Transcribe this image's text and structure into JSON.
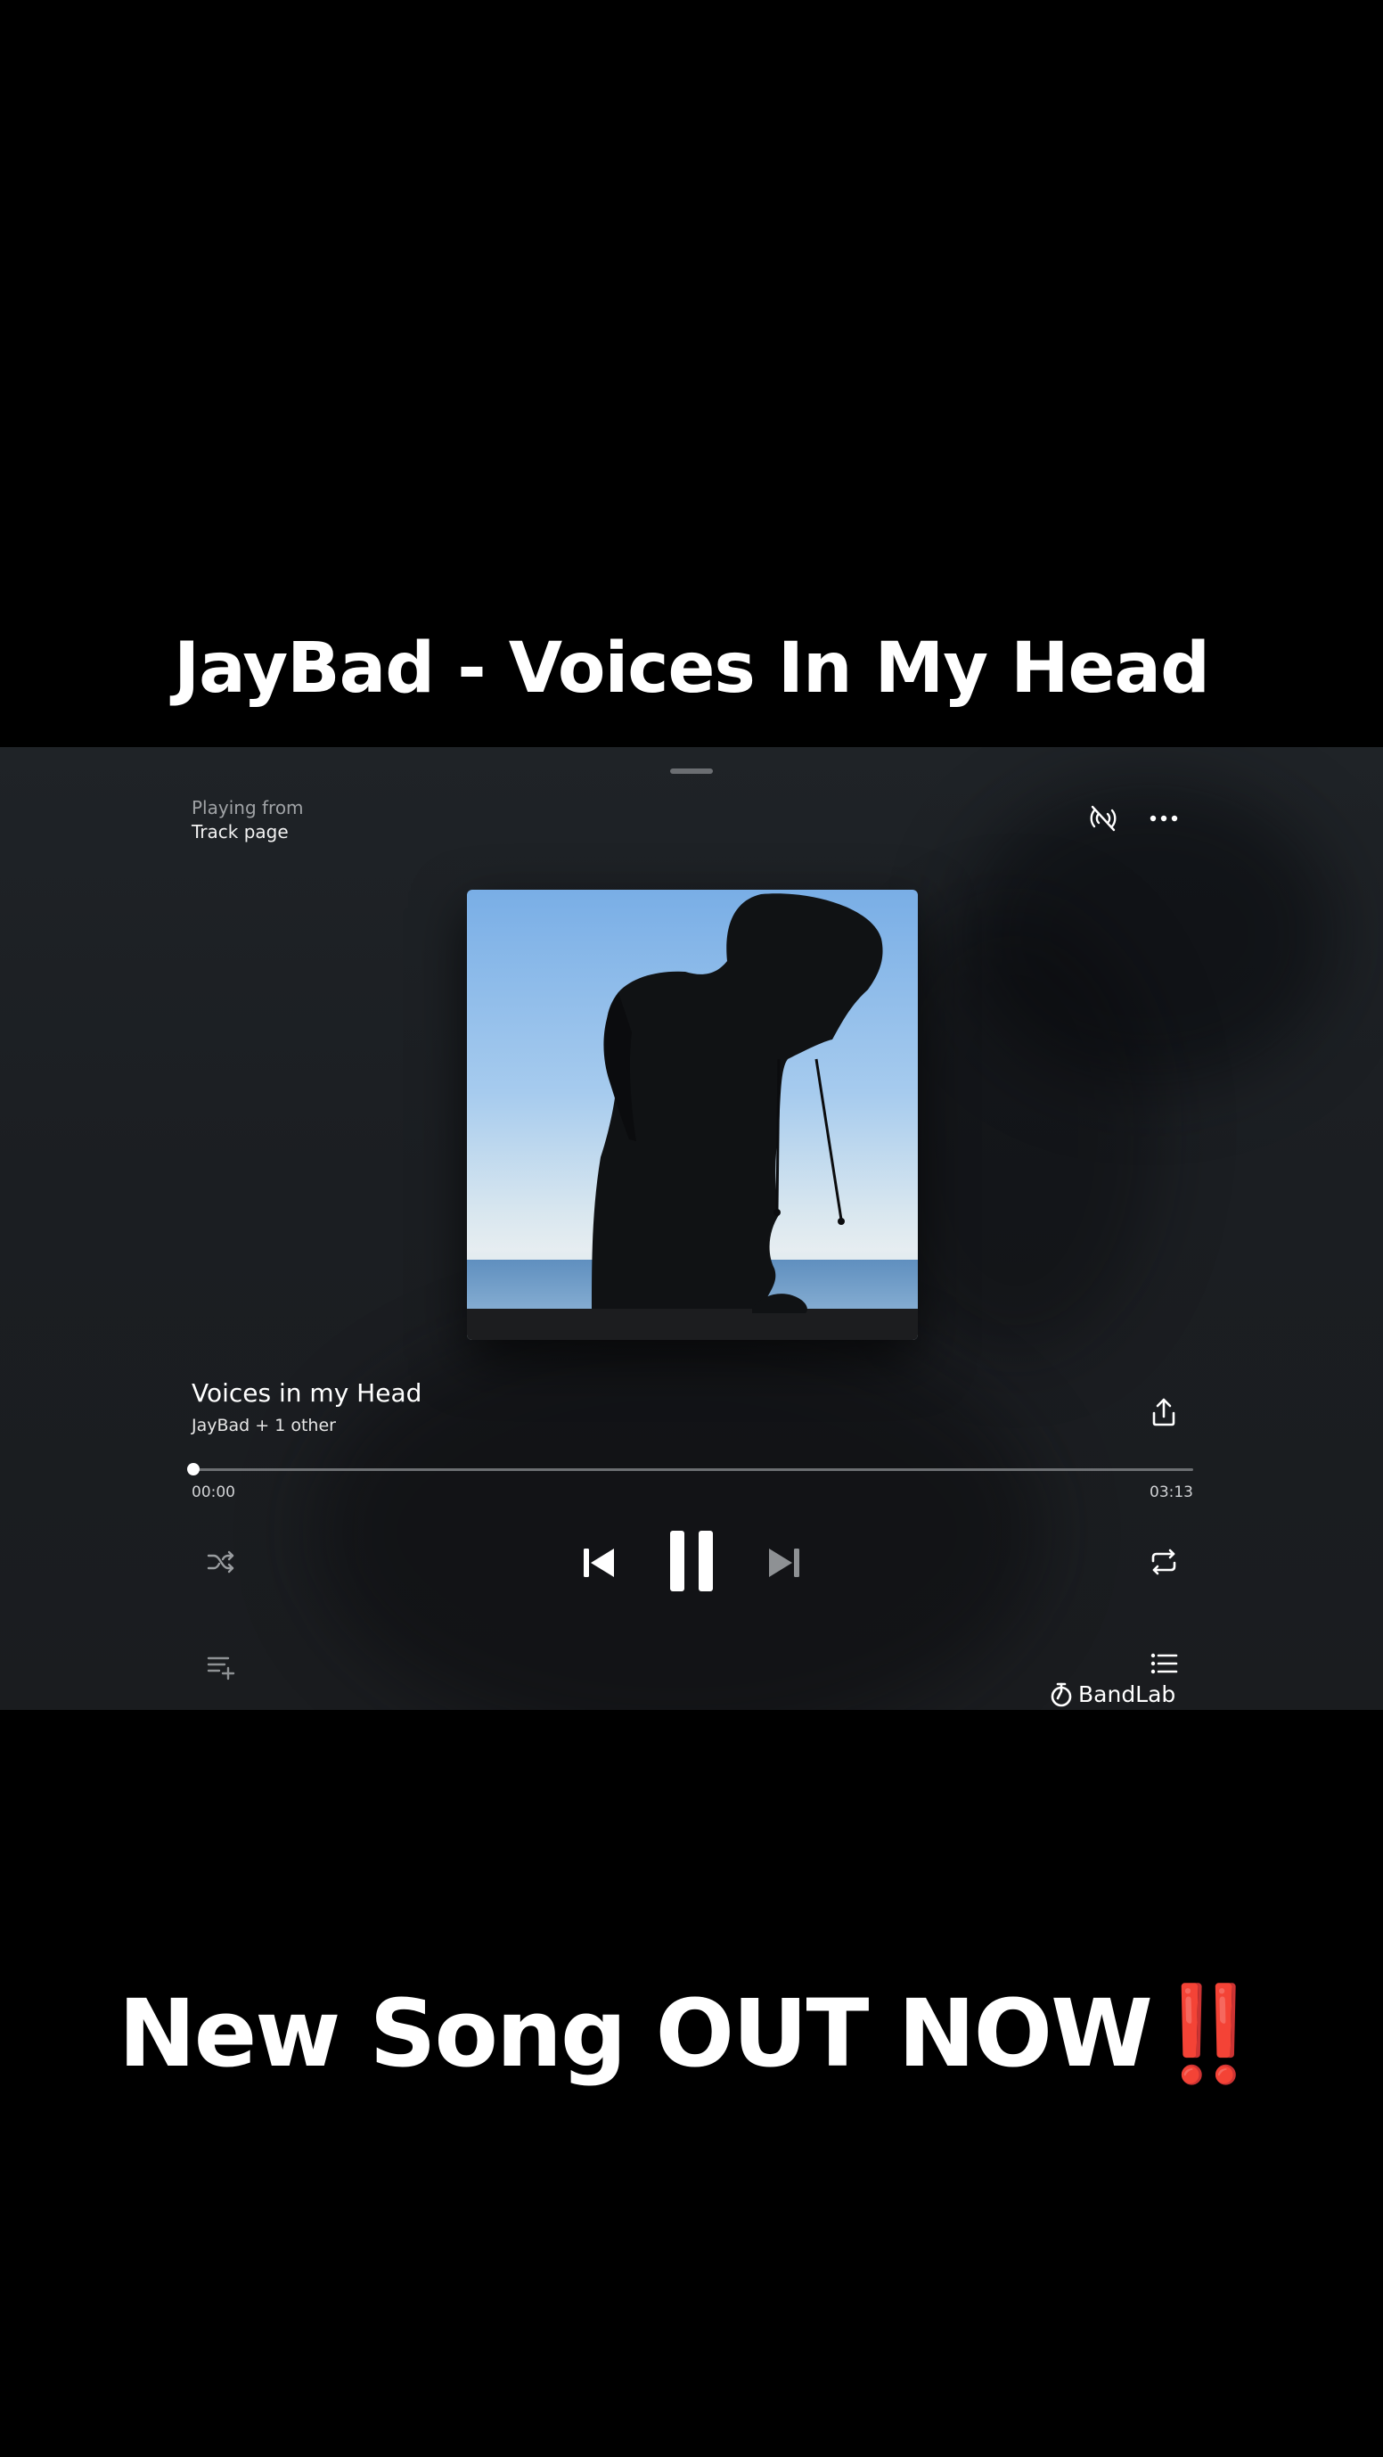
{
  "captions": {
    "top": "JayBad - Voices In My Head",
    "bottom_text": "New Song OUT NOW",
    "bottom_emoji": "‼️"
  },
  "player": {
    "playing_from_label": "Playing from",
    "playing_from_source": "Track page",
    "track": {
      "title": "Voices in my Head",
      "artist": "JayBad + 1 other"
    },
    "progress": {
      "elapsed": "00:00",
      "duration": "03:13",
      "fraction": 0.0
    },
    "icons": {
      "cast": "no-cast-icon",
      "more": "more-options-icon",
      "share": "share-icon",
      "shuffle": "shuffle-icon",
      "previous": "skip-previous-icon",
      "pause": "pause-icon",
      "next": "skip-next-icon",
      "repeat": "repeat-icon",
      "add_to_queue": "add-to-queue-icon",
      "queue": "queue-list-icon"
    },
    "brand": "BandLab"
  },
  "colors": {
    "background": "#000000",
    "panel": "#1d2024",
    "caption_text": "#ffffff",
    "exclamation": "#e01010"
  }
}
